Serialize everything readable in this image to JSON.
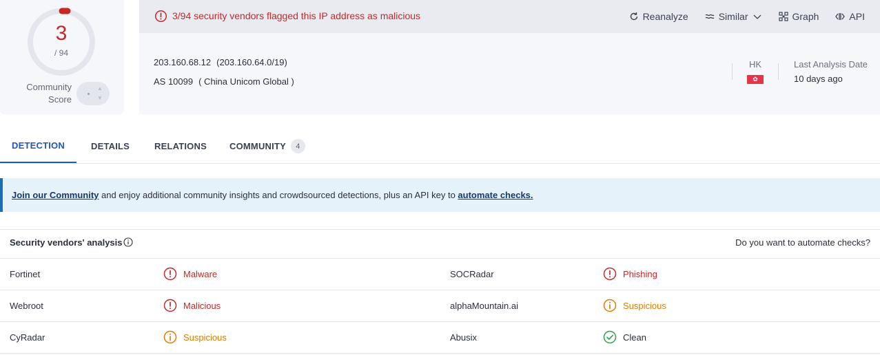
{
  "score": {
    "value": "3",
    "total": "/ 94",
    "label_line1": "Community",
    "label_line2": "Score",
    "colors": {
      "flagged": "#c62828",
      "ring": "#e3e6ec"
    }
  },
  "alert": {
    "text": "3/94 security vendors flagged this IP address as malicious",
    "color": "#c62828"
  },
  "actions": [
    {
      "label": "Reanalyze",
      "icon": "refresh-icon"
    },
    {
      "label": "Similar",
      "icon": "similar-icon"
    },
    {
      "label": "Graph",
      "icon": "graph-icon"
    },
    {
      "label": "API",
      "icon": "api-icon"
    }
  ],
  "ip": {
    "address": "203.160.68.12",
    "cidr": "(203.160.64.0/19)",
    "as": "AS 10099",
    "as_name": "( China Unicom Global )"
  },
  "location": {
    "country": "HK",
    "flag_icon": "hong-kong-flag-icon"
  },
  "last_analysis": {
    "label": "Last Analysis Date",
    "value": "10 days ago"
  },
  "tabs": [
    {
      "label": "DETECTION",
      "active": true
    },
    {
      "label": "DETAILS"
    },
    {
      "label": "RELATIONS"
    },
    {
      "label": "COMMUNITY",
      "badge": "4"
    }
  ],
  "banner": {
    "link1": "Join our Community",
    "middle": " and enjoy additional community insights and crowdsourced detections, plus an API key to ",
    "link2": "automate checks.",
    "accent": "#1b6fb5"
  },
  "vendors": {
    "title": "Security vendors' analysis",
    "automate_question": "Do you want to automate checks?",
    "rows": [
      {
        "left": {
          "vendor": "Fortinet",
          "result": "Malware",
          "status": "malicious"
        },
        "right": {
          "vendor": "SOCRadar",
          "result": "Phishing",
          "status": "malicious"
        }
      },
      {
        "left": {
          "vendor": "Webroot",
          "result": "Malicious",
          "status": "malicious"
        },
        "right": {
          "vendor": "alphaMountain.ai",
          "result": "Suspicious",
          "status": "suspicious"
        }
      },
      {
        "left": {
          "vendor": "CyRadar",
          "result": "Suspicious",
          "status": "suspicious"
        },
        "right": {
          "vendor": "Abusix",
          "result": "Clean",
          "status": "clean"
        }
      }
    ]
  }
}
